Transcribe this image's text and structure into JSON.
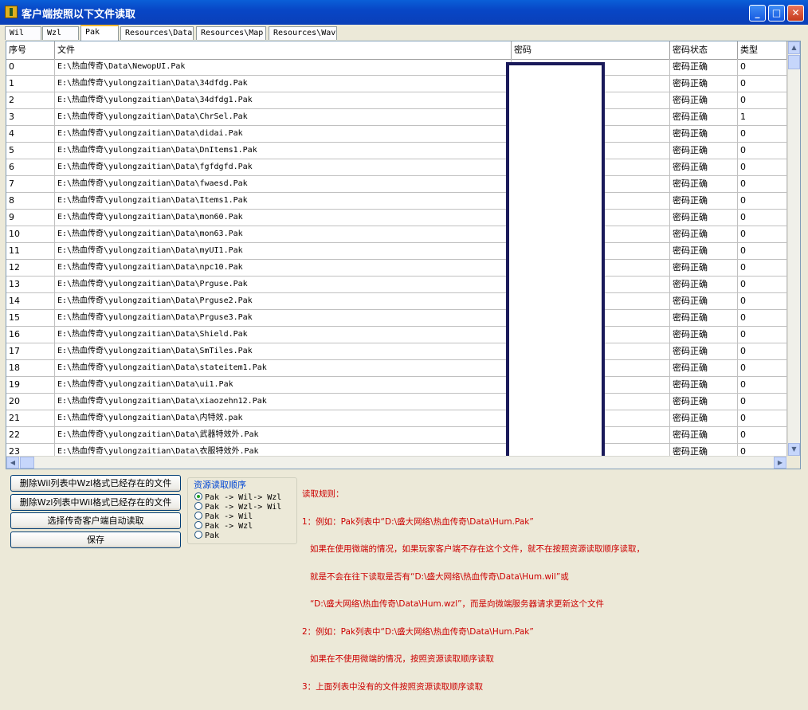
{
  "window": {
    "title": "客户端按照以下文件读取",
    "controls": {
      "minimize": "_",
      "maximize": "□",
      "close": "✕"
    },
    "icon": "app-icon"
  },
  "tabs": [
    {
      "label": "Wil",
      "active": false
    },
    {
      "label": "Wzl",
      "active": false
    },
    {
      "label": "Pak",
      "active": true
    },
    {
      "label": "Resources\\Data",
      "active": false
    },
    {
      "label": "Resources\\Map",
      "active": false
    },
    {
      "label": "Resources\\Wav",
      "active": false
    }
  ],
  "table": {
    "columns": [
      "序号",
      "文件",
      "密码",
      "密码状态",
      "类型"
    ],
    "rows": [
      {
        "no": "0",
        "file": "E:\\热血传奇\\Data\\NewopUI.Pak",
        "status": "密码正确",
        "type": "0"
      },
      {
        "no": "1",
        "file": "E:\\热血传奇\\yulongzaitian\\Data\\34dfdg.Pak",
        "status": "密码正确",
        "type": "0"
      },
      {
        "no": "2",
        "file": "E:\\热血传奇\\yulongzaitian\\Data\\34dfdg1.Pak",
        "status": "密码正确",
        "type": "0"
      },
      {
        "no": "3",
        "file": "E:\\热血传奇\\yulongzaitian\\Data\\ChrSel.Pak",
        "status": "密码正确",
        "type": "1"
      },
      {
        "no": "4",
        "file": "E:\\热血传奇\\yulongzaitian\\Data\\didai.Pak",
        "status": "密码正确",
        "type": "0"
      },
      {
        "no": "5",
        "file": "E:\\热血传奇\\yulongzaitian\\Data\\DnItems1.Pak",
        "status": "密码正确",
        "type": "0"
      },
      {
        "no": "6",
        "file": "E:\\热血传奇\\yulongzaitian\\Data\\fgfdgfd.Pak",
        "status": "密码正确",
        "type": "0"
      },
      {
        "no": "7",
        "file": "E:\\热血传奇\\yulongzaitian\\Data\\fwaesd.Pak",
        "status": "密码正确",
        "type": "0"
      },
      {
        "no": "8",
        "file": "E:\\热血传奇\\yulongzaitian\\Data\\Items1.Pak",
        "status": "密码正确",
        "type": "0"
      },
      {
        "no": "9",
        "file": "E:\\热血传奇\\yulongzaitian\\Data\\mon60.Pak",
        "status": "密码正确",
        "type": "0"
      },
      {
        "no": "10",
        "file": "E:\\热血传奇\\yulongzaitian\\Data\\mon63.Pak",
        "status": "密码正确",
        "type": "0"
      },
      {
        "no": "11",
        "file": "E:\\热血传奇\\yulongzaitian\\Data\\myUI1.Pak",
        "status": "密码正确",
        "type": "0"
      },
      {
        "no": "12",
        "file": "E:\\热血传奇\\yulongzaitian\\Data\\npc10.Pak",
        "status": "密码正确",
        "type": "0"
      },
      {
        "no": "13",
        "file": "E:\\热血传奇\\yulongzaitian\\Data\\Prguse.Pak",
        "status": "密码正确",
        "type": "0"
      },
      {
        "no": "14",
        "file": "E:\\热血传奇\\yulongzaitian\\Data\\Prguse2.Pak",
        "status": "密码正确",
        "type": "0"
      },
      {
        "no": "15",
        "file": "E:\\热血传奇\\yulongzaitian\\Data\\Prguse3.Pak",
        "status": "密码正确",
        "type": "0"
      },
      {
        "no": "16",
        "file": "E:\\热血传奇\\yulongzaitian\\Data\\Shield.Pak",
        "status": "密码正确",
        "type": "0"
      },
      {
        "no": "17",
        "file": "E:\\热血传奇\\yulongzaitian\\Data\\SmTiles.Pak",
        "status": "密码正确",
        "type": "0"
      },
      {
        "no": "18",
        "file": "E:\\热血传奇\\yulongzaitian\\Data\\stateitem1.Pak",
        "status": "密码正确",
        "type": "0"
      },
      {
        "no": "19",
        "file": "E:\\热血传奇\\yulongzaitian\\Data\\ui1.Pak",
        "status": "密码正确",
        "type": "0"
      },
      {
        "no": "20",
        "file": "E:\\热血传奇\\yulongzaitian\\Data\\xiaozehn12.Pak",
        "status": "密码正确",
        "type": "0"
      },
      {
        "no": "21",
        "file": "E:\\热血传奇\\yulongzaitian\\Data\\内特效.pak",
        "status": "密码正确",
        "type": "0"
      },
      {
        "no": "22",
        "file": "E:\\热血传奇\\yulongzaitian\\Data\\武器特效外.Pak",
        "status": "密码正确",
        "type": "0"
      },
      {
        "no": "23",
        "file": "E:\\热血传奇\\yulongzaitian\\Data\\衣服特效外.Pak",
        "status": "密码正确",
        "type": "0"
      }
    ]
  },
  "buttons": {
    "delete_wil": "删除Wil列表中Wzl格式已经存在的文件",
    "delete_wzl": "删除Wzl列表中Wil格式已经存在的文件",
    "select_client": "选择传奇客户端自动读取",
    "save": "保存"
  },
  "resource_order": {
    "title": "资源读取顺序",
    "options": [
      {
        "label": "Pak -> Wil-> Wzl",
        "selected": true
      },
      {
        "label": "Pak -> Wzl-> Wil",
        "selected": false
      },
      {
        "label": "Pak -> Wil",
        "selected": false
      },
      {
        "label": "Pak -> Wzl",
        "selected": false
      },
      {
        "label": "Pak",
        "selected": false
      }
    ]
  },
  "rules": {
    "lines": [
      "读取规则：",
      "1：例如：Pak列表中“D:\\盛大网络\\热血传奇\\Data\\Hum.Pak”",
      "   如果在使用微端的情况，如果玩家客户端不存在这个文件，就不在按照资源读取顺序读取，",
      "   就是不会在往下读取是否有“D:\\盛大网络\\热血传奇\\Data\\Hum.wil”或",
      "   “D:\\盛大网络\\热血传奇\\Data\\Hum.wzl”，而是向微端服务器请求更新这个文件",
      "2：例如：Pak列表中“D:\\盛大网络\\热血传奇\\Data\\Hum.Pak”",
      "   如果在不使用微端的情况，按照资源读取顺序读取",
      "3：上面列表中没有的文件按照资源读取顺序读取"
    ]
  },
  "colors": {
    "title_bar": "#0846c6",
    "rules_text": "#cc0000",
    "group_title": "#0046d5",
    "redaction_border": "#1a1a5a"
  }
}
